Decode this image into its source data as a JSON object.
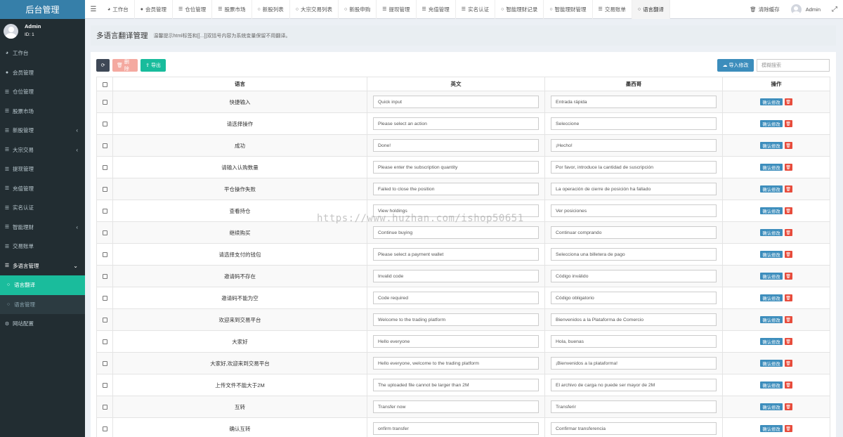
{
  "app": {
    "title": "后台管理"
  },
  "user": {
    "name": "Admin",
    "id": "ID: 1"
  },
  "sidebar": {
    "items": [
      {
        "label": "工作台",
        "icon": "dashboard-icon"
      },
      {
        "label": "会员管理",
        "icon": "user-circle-icon"
      },
      {
        "label": "仓位管理",
        "icon": "list-icon"
      },
      {
        "label": "股票市场",
        "icon": "list-icon"
      },
      {
        "label": "新股管理",
        "icon": "list-icon",
        "caret": "‹"
      },
      {
        "label": "大宗交易",
        "icon": "list-icon",
        "caret": "‹"
      },
      {
        "label": "提现管理",
        "icon": "list-icon"
      },
      {
        "label": "充值管理",
        "icon": "list-icon"
      },
      {
        "label": "实名认证",
        "icon": "list-icon"
      },
      {
        "label": "智能理财",
        "icon": "list-icon",
        "caret": "‹"
      },
      {
        "label": "交易账单",
        "icon": "list-icon"
      },
      {
        "label": "多语言管理",
        "icon": "list-icon",
        "caret": "⌄"
      },
      {
        "label": "语言翻译",
        "icon": "circle-icon"
      },
      {
        "label": "语言管理",
        "icon": "circle-icon"
      },
      {
        "label": "网站配置",
        "icon": "gear-icon"
      }
    ]
  },
  "topbar": {
    "tabs": [
      {
        "label": "工作台",
        "icon": "dashboard-icon"
      },
      {
        "label": "会员管理",
        "icon": "user-circle-icon"
      },
      {
        "label": "仓位管理",
        "icon": "list-icon"
      },
      {
        "label": "股票市场",
        "icon": "list-icon"
      },
      {
        "label": "新股列表",
        "icon": "circle-icon"
      },
      {
        "label": "大宗交易列表",
        "icon": "circle-icon"
      },
      {
        "label": "新股申购",
        "icon": "circle-icon"
      },
      {
        "label": "提现管理",
        "icon": "list-icon"
      },
      {
        "label": "充值管理",
        "icon": "list-icon"
      },
      {
        "label": "实名认证",
        "icon": "list-icon"
      },
      {
        "label": "智能理财记录",
        "icon": "circle-icon"
      },
      {
        "label": "智能理财管理",
        "icon": "circle-icon"
      },
      {
        "label": "交易账单",
        "icon": "list-icon"
      },
      {
        "label": "语言翻译",
        "icon": "circle-icon"
      }
    ],
    "clear_cache": "清除缓存",
    "admin": "Admin"
  },
  "page": {
    "title": "多语言翻译管理",
    "hint": "温馨提示html标签和[[...]]双括号内容为系统变量保留不用翻译。"
  },
  "toolbar": {
    "delete_label": "删除",
    "export_label": "导出",
    "import_label": "导入修改",
    "search_placeholder": "模糊搜索"
  },
  "table": {
    "headers": {
      "lang": "语言",
      "en": "英文",
      "mx": "墨西哥",
      "op": "操作"
    },
    "confirm_label": "确认修改",
    "rows": [
      {
        "lang": "快捷输入",
        "en": "Quick input",
        "mx": "Entrada rápida"
      },
      {
        "lang": "请选择操作",
        "en": "Please select an action",
        "mx": "Seleccione"
      },
      {
        "lang": "成功",
        "en": "Done!",
        "mx": "¡Hecho!"
      },
      {
        "lang": "请输入认购数量",
        "en": "Please enter the subscription quantity",
        "mx": "Por favor, introduce la cantidad de suscripción"
      },
      {
        "lang": "平仓操作失败",
        "en": "Failed to close the position",
        "mx": "La operación de cierre de posición ha fallado"
      },
      {
        "lang": "查看持仓",
        "en": "View holdings",
        "mx": "Ver posiciones"
      },
      {
        "lang": "继续购买",
        "en": "Continue buying",
        "mx": "Continuar comprando"
      },
      {
        "lang": "请选择支付的钱包",
        "en": "Please select a payment wallet",
        "mx": "Selecciona una billetera de pago"
      },
      {
        "lang": "邀请码不存在",
        "en": "Invalid code",
        "mx": "Código inválido"
      },
      {
        "lang": "邀请码不能为空",
        "en": "Code required",
        "mx": "Código obligatorio"
      },
      {
        "lang": "欢迎来到交易平台",
        "en": "Welcome to the trading platform",
        "mx": "Bienvenidos a la Plataforma de Comercio"
      },
      {
        "lang": "大家好",
        "en": "Hello everyone",
        "mx": "Hola, buenas"
      },
      {
        "lang": "大家好,欢迎来到交易平台",
        "en": "Hello everyone, welcome to the trading platform",
        "mx": "¡Bienvenidos a la plataforma!"
      },
      {
        "lang": "上传文件不能大于2M",
        "en": "The uploaded file cannot be larger than 2M",
        "mx": "El archivo de carga no puede ser mayor de 2M"
      },
      {
        "lang": "互转",
        "en": "Transfer now",
        "mx": "Transferir"
      },
      {
        "lang": "确认互转",
        "en": "onfirm transfer",
        "mx": "Confirmar transferencia"
      }
    ]
  },
  "watermark": "https://www.huzhan.com/ishop50651"
}
